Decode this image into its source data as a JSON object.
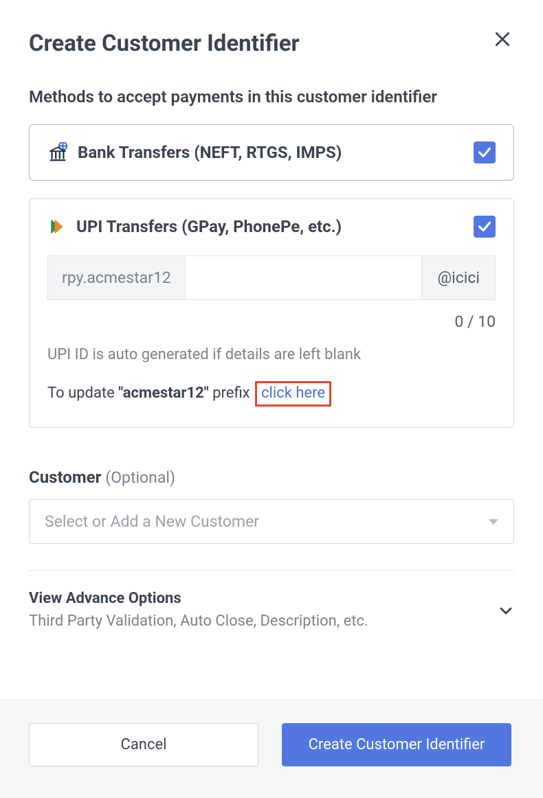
{
  "header": {
    "title": "Create Customer Identifier"
  },
  "methods": {
    "section_label": "Methods to accept payments in this customer identifier",
    "bank": {
      "label": "Bank Transfers (NEFT, RTGS, IMPS)",
      "checked": true
    },
    "upi": {
      "label": "UPI Transfers (GPay, PhonePe, etc.)",
      "checked": true,
      "prefix": "rpy.acmestar12",
      "suffix": "@icici",
      "char_count": "0 / 10",
      "auto_note": "UPI ID is auto generated if details are left blank",
      "update_prefix_text": "To update ",
      "update_prefix_value": "\"acmestar12\"",
      "update_suffix_text": " prefix",
      "click_here": "click here"
    }
  },
  "customer": {
    "label": "Customer",
    "optional": "(Optional)",
    "placeholder": "Select or Add a New Customer"
  },
  "advance": {
    "title": "View Advance Options",
    "desc": "Third Party Validation, Auto Close, Description, etc."
  },
  "footer": {
    "cancel": "Cancel",
    "submit": "Create Customer Identifier"
  }
}
